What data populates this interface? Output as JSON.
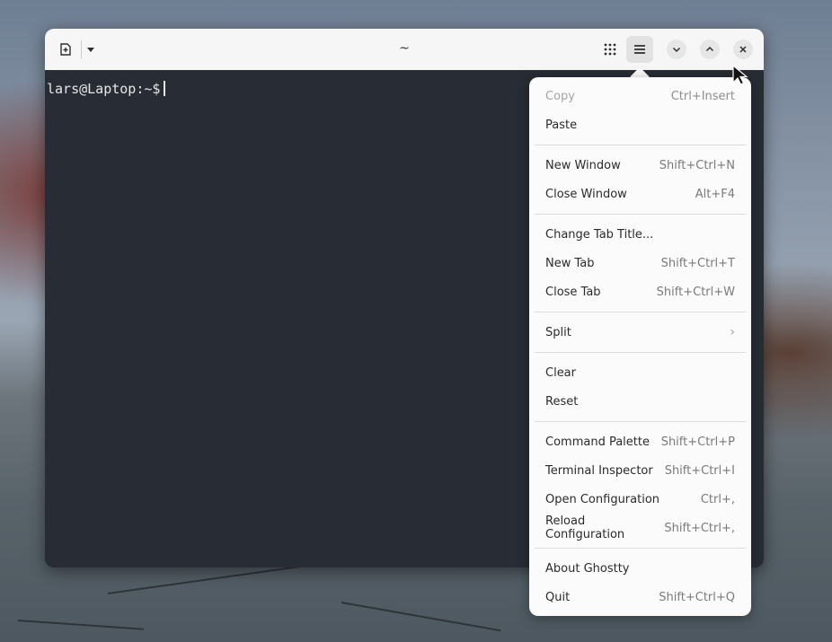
{
  "window": {
    "title": "~"
  },
  "terminal": {
    "prompt": "lars@Laptop:~$"
  },
  "menu": {
    "items": [
      {
        "label": "Copy",
        "accel": "Ctrl+Insert",
        "disabled": true
      },
      {
        "label": "Paste",
        "accel": ""
      },
      {
        "label": "New Window",
        "accel": "Shift+Ctrl+N"
      },
      {
        "label": "Close Window",
        "accel": "Alt+F4"
      },
      {
        "label": "Change Tab Title...",
        "accel": ""
      },
      {
        "label": "New Tab",
        "accel": "Shift+Ctrl+T"
      },
      {
        "label": "Close Tab",
        "accel": "Shift+Ctrl+W"
      },
      {
        "label": "Split",
        "accel": "",
        "submenu": true
      },
      {
        "label": "Clear",
        "accel": ""
      },
      {
        "label": "Reset",
        "accel": ""
      },
      {
        "label": "Command Palette",
        "accel": "Shift+Ctrl+P"
      },
      {
        "label": "Terminal Inspector",
        "accel": "Shift+Ctrl+I"
      },
      {
        "label": "Open Configuration",
        "accel": "Ctrl+,"
      },
      {
        "label": "Reload Configuration",
        "accel": "Shift+Ctrl+,"
      },
      {
        "label": "About Ghostty",
        "accel": ""
      },
      {
        "label": "Quit",
        "accel": "Shift+Ctrl+Q"
      }
    ]
  },
  "icons": {
    "new_tab": "new-tab-icon",
    "dropdown": "chevron-down-icon",
    "grid": "grid-icon",
    "menu": "hamburger-menu-icon",
    "minimize": "minimize-icon",
    "maximize": "maximize-icon",
    "close": "close-icon"
  }
}
